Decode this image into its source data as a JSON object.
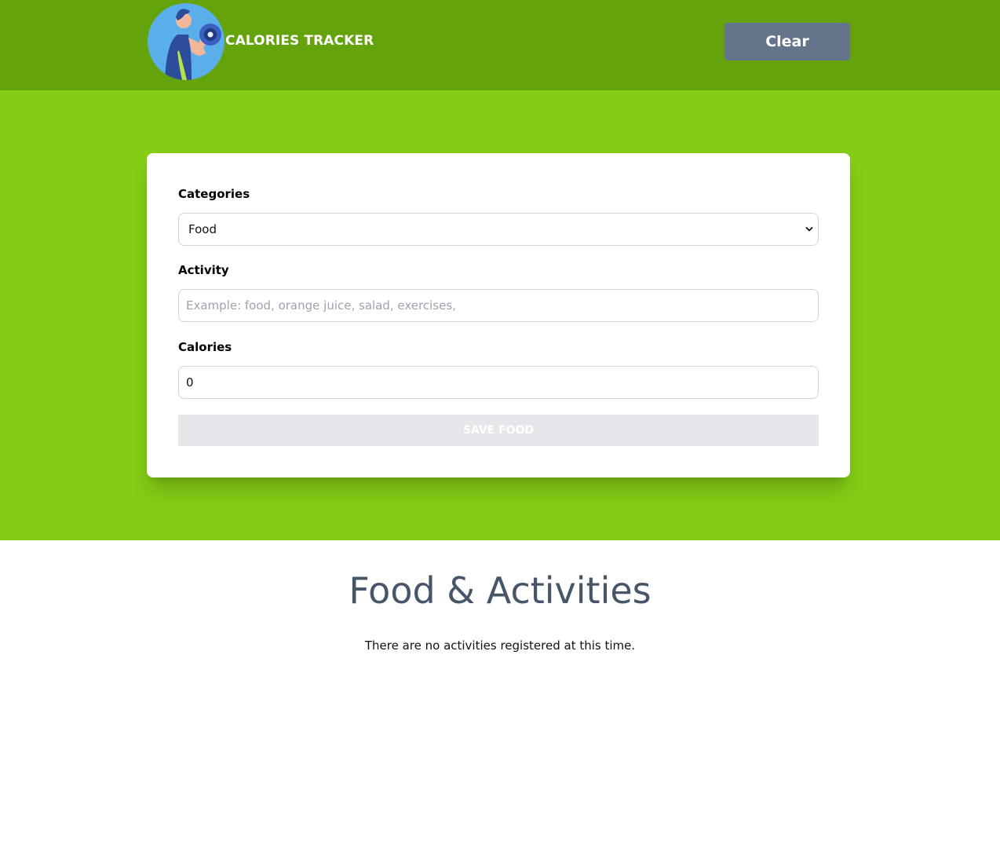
{
  "header": {
    "logo_icon": "fitness-man-dumbbell-icon",
    "title": "CALORIES TRACKER",
    "clear_label": "Clear"
  },
  "form": {
    "category_label": "Categories",
    "category_value": "Food",
    "category_icon": "chevron-down-icon",
    "activity_label": "Activity",
    "activity_placeholder": "Example: food, orange juice, salad, exercises,",
    "activity_value": "",
    "calories_label": "Calories",
    "calories_value": "0",
    "save_label": "Save Food"
  },
  "list": {
    "title": "Food & Activities",
    "empty_message": "There are no activities registered at this time."
  },
  "colors": {
    "header_bg": "#65a30d",
    "hero_bg": "#84cc16",
    "clear_button_bg": "#64748b",
    "save_button_disabled_bg": "#e5e7eb",
    "title_text": "#475569"
  }
}
